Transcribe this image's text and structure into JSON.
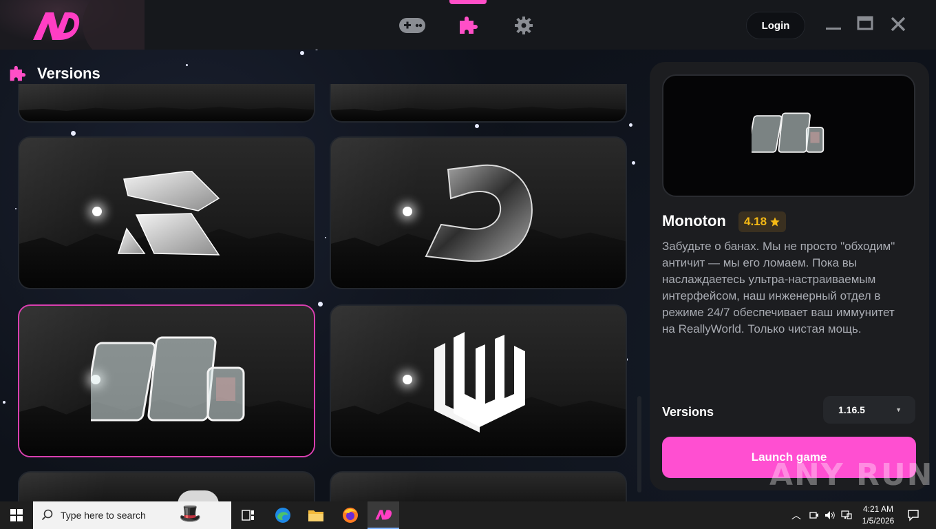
{
  "header": {
    "nav": [
      {
        "name": "games-tab",
        "icon": "gamepad-icon",
        "active": false
      },
      {
        "name": "versions-tab",
        "icon": "puzzle-icon",
        "active": true
      },
      {
        "name": "settings-tab",
        "icon": "gear-icon",
        "active": false
      }
    ],
    "login_label": "Login",
    "accent_color": "#ff4fc7"
  },
  "versions_section": {
    "title": "Versions",
    "icon": "puzzle-icon",
    "cards": [
      {
        "name": "partial-top-left",
        "logo": "unknown"
      },
      {
        "name": "partial-top-right",
        "logo": "unknown"
      },
      {
        "name": "card-r",
        "logo": "crystal-r-logo"
      },
      {
        "name": "card-d",
        "logo": "chrome-d-logo"
      },
      {
        "name": "card-monoton",
        "logo": "glass-blocks-logo",
        "selected": true
      },
      {
        "name": "card-lw",
        "logo": "white-lw-logo"
      },
      {
        "name": "partial-bottom-left",
        "logo": "unknown"
      },
      {
        "name": "partial-bottom-right",
        "logo": "unknown"
      }
    ]
  },
  "details": {
    "name": "Monoton",
    "rating": "4.18",
    "rating_icon": "star-icon",
    "description": "Забудьте о банах. Мы не просто \"обходим\" античит — мы его ломаем. Пока вы наслаждаетесь ультра-настраиваемым интерфейсом, наш инженерный отдел в режиме 24/7 обеспечивает ваш иммунитет на ReallyWorld. Только чистая мощь.",
    "versions_label": "Versions",
    "selected_version": "1.16.5",
    "launch_label": "Launch game"
  },
  "watermark": "ANY RUN",
  "taskbar": {
    "search_placeholder": "Type here to search",
    "time": "4:21 AM",
    "date": "1/5/2026"
  }
}
